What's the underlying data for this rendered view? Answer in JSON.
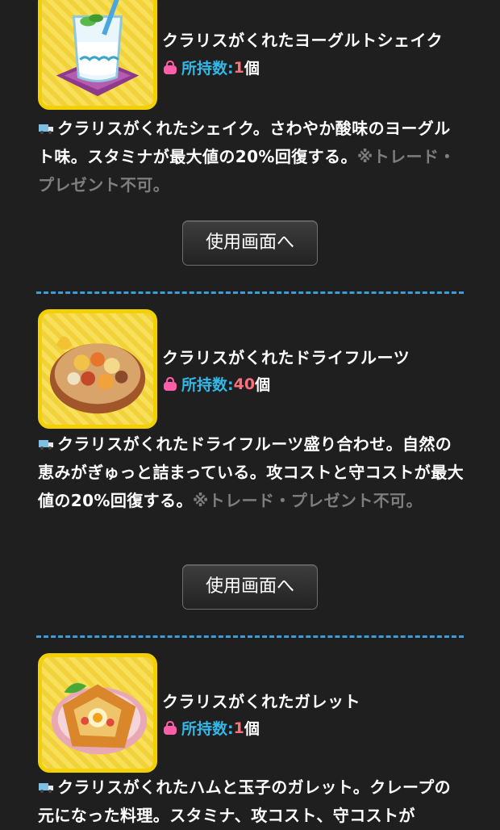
{
  "items": [
    {
      "title": "クラリスがくれたヨーグルトシェイク",
      "count_label": "所持数:",
      "count_value": "1",
      "count_unit": "個",
      "description": "クラリスがくれたシェイク。さわやか酸味のヨーグルト味。スタミナが最大値の20%回復する。",
      "note": "※トレード・プレゼント不可。",
      "button_label": "使用画面へ",
      "icon": "yogurt-shake-icon"
    },
    {
      "title": "クラリスがくれたドライフルーツ",
      "count_label": "所持数:",
      "count_value": "40",
      "count_unit": "個",
      "description": "クラリスがくれたドライフルーツ盛り合わせ。自然の恵みがぎゅっと詰まっている。攻コストと守コストが最大値の20%回復する。",
      "note": "※トレード・プレゼント不可。",
      "button_label": "使用画面へ",
      "icon": "dried-fruit-icon"
    },
    {
      "title": "クラリスがくれたガレット",
      "count_label": "所持数:",
      "count_value": "1",
      "count_unit": "個",
      "description": "クラリスがくれたハムと玉子のガレット。クレープの元になった料理。スタミナ、攻コスト、守コストが",
      "icon": "galette-icon"
    }
  ],
  "colors": {
    "background": "#1f1f1f",
    "count_label": "#33b8e8",
    "count_value": "#ff6f79",
    "note": "#7e7e7e",
    "separator": "#3a9fd8",
    "thumb_border": "#f3d000"
  }
}
